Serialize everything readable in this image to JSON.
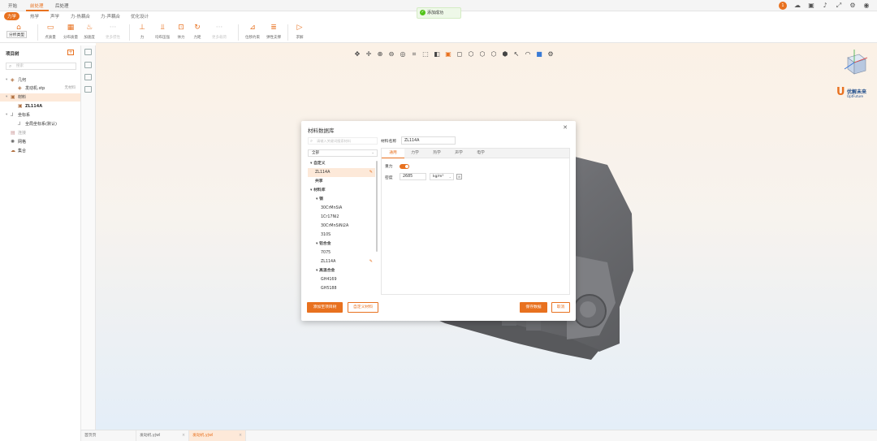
{
  "top_tabs": [
    "开始",
    "前处理",
    "后处理"
  ],
  "sub_tabs": [
    "力学",
    "热学",
    "声学",
    "力-热耦合",
    "力-声耦合",
    "优化设计"
  ],
  "ribbon": {
    "dropdown": "分析类型",
    "items": [
      {
        "label": "点质量",
        "icon": "point-mass"
      },
      {
        "label": "分布质量",
        "icon": "distributed-mass"
      },
      {
        "label": "加速度",
        "icon": "acceleration"
      },
      {
        "label": "更多惯性",
        "icon": "more-inertia",
        "disabled": true
      },
      {
        "label": "力",
        "icon": "force"
      },
      {
        "label": "均布压强",
        "icon": "pressure"
      },
      {
        "label": "体力",
        "icon": "body-force"
      },
      {
        "label": "力矩",
        "icon": "moment"
      },
      {
        "label": "更多载荷",
        "icon": "more-loads",
        "disabled": true
      },
      {
        "label": "位移约束",
        "icon": "displacement"
      },
      {
        "label": "弹性支撑",
        "icon": "elastic-support"
      },
      {
        "label": "求解",
        "icon": "solve"
      }
    ]
  },
  "toast": "添加成功",
  "left_panel": {
    "title": "项目树",
    "search_placeholder": "搜索",
    "tree": [
      {
        "label": "几何",
        "level": 0,
        "caret": "▾",
        "icon": "geometry-icon"
      },
      {
        "label": "发动机.stp",
        "level": 1,
        "right": "无材料",
        "icon": "part-icon"
      },
      {
        "label": "材料",
        "level": 0,
        "caret": "▾",
        "icon": "material-icon",
        "selected": true
      },
      {
        "label": "ZL114A",
        "level": 1,
        "icon": "material-item-icon"
      },
      {
        "label": "坐标系",
        "level": 0,
        "caret": "▾",
        "icon": "coordinate-icon"
      },
      {
        "label": "全局坐标系(默认)",
        "level": 1,
        "icon": "axis-icon"
      },
      {
        "label": "连接",
        "level": 0,
        "icon": "connection-icon",
        "muted": true
      },
      {
        "label": "网格",
        "level": 0,
        "icon": "mesh-icon"
      },
      {
        "label": "集合",
        "level": 0,
        "icon": "set-icon"
      }
    ]
  },
  "dialog": {
    "title": "材料数据库",
    "search_placeholder": "请输入关键词搜索材料",
    "filter": "全部",
    "name_label": "材料名称",
    "name_value": "ZL114A",
    "materials": [
      {
        "label": "自定义",
        "type": "group",
        "caret": "▾"
      },
      {
        "label": "ZL114A",
        "type": "item",
        "selected": true,
        "editable": true
      },
      {
        "label": "共享",
        "type": "group"
      },
      {
        "label": "材料库",
        "type": "group",
        "caret": "▾"
      },
      {
        "label": "钢",
        "type": "subgroup",
        "caret": "▾"
      },
      {
        "label": "30CrMnSiA",
        "type": "item"
      },
      {
        "label": "1Cr17Ni2",
        "type": "item"
      },
      {
        "label": "30CrMnSiNi2A",
        "type": "item"
      },
      {
        "label": "310S",
        "type": "item"
      },
      {
        "label": "铝合金",
        "type": "subgroup",
        "caret": "▾"
      },
      {
        "label": "7075",
        "type": "item"
      },
      {
        "label": "ZL114A",
        "type": "item",
        "editable": true
      },
      {
        "label": "高温合金",
        "type": "subgroup",
        "caret": "▾"
      },
      {
        "label": "GH4169",
        "type": "item"
      },
      {
        "label": "GH5188",
        "type": "item"
      }
    ],
    "prop_tabs": [
      "通用",
      "力学",
      "热学",
      "声学",
      "电学"
    ],
    "gravity_label": "重力",
    "density_label": "密度",
    "density_value": "2685",
    "density_unit": "kg/m³",
    "buttons": {
      "add_to_tree": "添加至项目树",
      "custom_material": "自定义材料",
      "save": "保存数据",
      "cancel": "取消"
    }
  },
  "logo": {
    "cn": "优解未来",
    "en": "OptFuture"
  },
  "bottom_tabs": [
    {
      "label": "首页页"
    },
    {
      "label": "发动机.yjwl"
    },
    {
      "label": "发动机.yjwl",
      "active": true
    }
  ],
  "colors": {
    "accent": "#e8711f",
    "success": "#52c41a",
    "brand_blue": "#1f4d8a"
  }
}
